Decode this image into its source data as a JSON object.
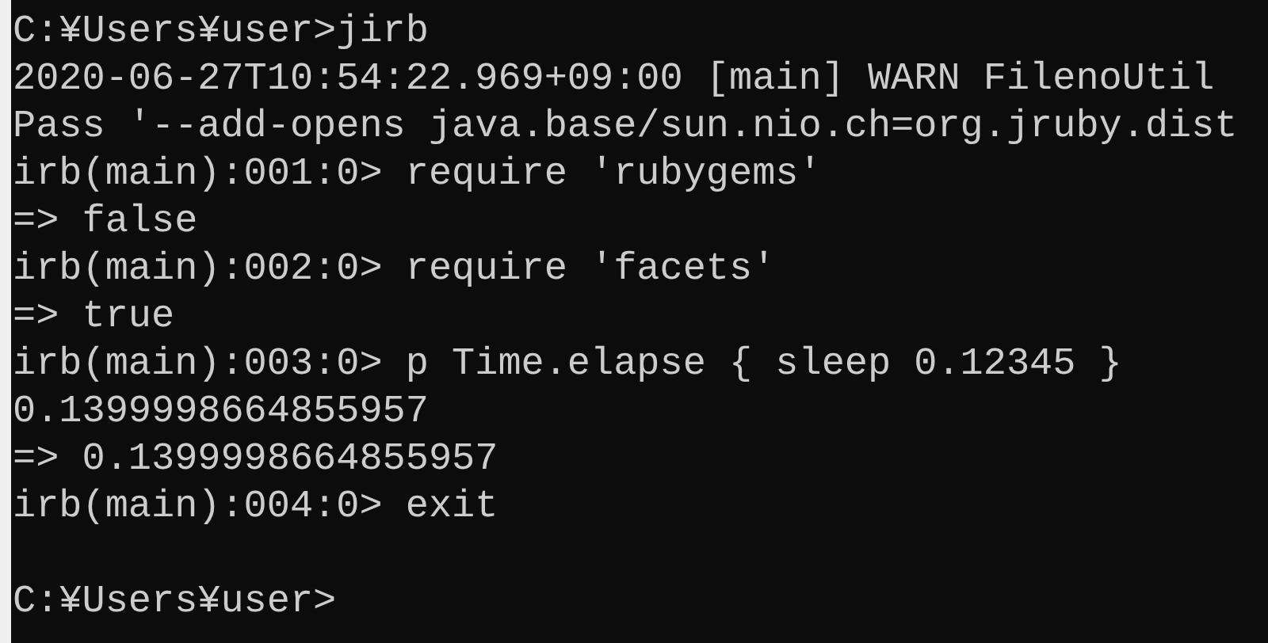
{
  "terminal": {
    "lines": [
      "C:¥Users¥user>jirb",
      "2020-06-27T10:54:22.969+09:00 [main] WARN FilenoUtil",
      "Pass '--add-opens java.base/sun.nio.ch=org.jruby.dist",
      "irb(main):001:0> require 'rubygems'",
      "=> false",
      "irb(main):002:0> require 'facets'",
      "=> true",
      "irb(main):003:0> p Time.elapse { sleep 0.12345 }",
      "0.1399998664855957",
      "=> 0.1399998664855957",
      "irb(main):004:0> exit"
    ],
    "prompt": "C:¥Users¥user>"
  }
}
